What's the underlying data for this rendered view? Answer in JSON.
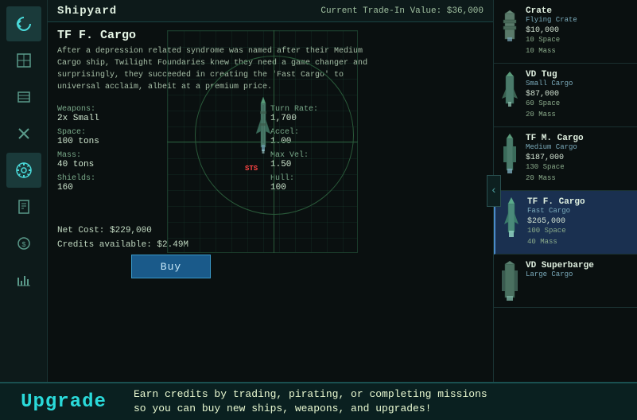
{
  "header": {
    "title": "Shipyard",
    "trade_in": "Current Trade-In Value: $36,000"
  },
  "ship": {
    "name": "TF F. Cargo",
    "description": "After a depression related syndrome was named after their Medium Cargo ship, Twilight Foundaries knew they need a game changer and surprisingly, they succeeded in creating the 'Fast Cargo' to universal acclaim, albeit at a premium price.",
    "weapons_label": "Weapons:",
    "weapons_value": "2x Small",
    "turn_rate_label": "Turn Rate:",
    "turn_rate_value": "1,700",
    "space_label": "Space:",
    "space_value": "100 tons",
    "accel_label": "Accel:",
    "accel_value": "1.00",
    "mass_label": "Mass:",
    "mass_value": "40 tons",
    "max_vel_label": "Max Vel:",
    "max_vel_value": "1.50",
    "shields_label": "Shields:",
    "shields_value": "160",
    "hull_label": "Hull:",
    "hull_value": "100",
    "net_cost": "Net Cost: $229,000",
    "credits": "Credits available: $2.49M",
    "buy_label": "Buy",
    "sts": "STS"
  },
  "ship_list": [
    {
      "name": "Crate",
      "type": "Flying Crate",
      "price": "$10,000",
      "stats": "10 Space\n10 Mass",
      "selected": false
    },
    {
      "name": "VD Tug",
      "type": "Small Cargo",
      "price": "$87,000",
      "stats": "60 Space\n20 Mass",
      "selected": false
    },
    {
      "name": "TF M. Cargo",
      "type": "Medium Cargo",
      "price": "$187,000",
      "stats": "130 Space\n20 Mass",
      "selected": false
    },
    {
      "name": "TF F. Cargo",
      "type": "Fast Cargo",
      "price": "$265,000",
      "stats": "100 Space\n40 Mass",
      "selected": true
    },
    {
      "name": "VD Superbarge",
      "type": "Large Cargo",
      "price": "",
      "stats": "",
      "selected": false
    }
  ],
  "collapse_arrow": "‹",
  "bottom": {
    "upgrade_label": "Upgrade",
    "tip": "Earn credits by trading, pirating, or completing missions\nso you can buy new ships, weapons, and upgrades!"
  },
  "sidebar": {
    "icons": [
      {
        "name": "back-icon",
        "glyph": "↩",
        "active": true
      },
      {
        "name": "map-icon",
        "glyph": "◈",
        "active": false
      },
      {
        "name": "cargo-icon",
        "glyph": "☰",
        "active": false
      },
      {
        "name": "tools-icon",
        "glyph": "✦",
        "active": false
      },
      {
        "name": "helm-icon",
        "glyph": "✿",
        "active": true
      },
      {
        "name": "missions-icon",
        "glyph": "✎",
        "active": false
      },
      {
        "name": "trade-icon",
        "glyph": "◈",
        "active": false
      },
      {
        "name": "finance-icon",
        "glyph": "◐",
        "active": false
      },
      {
        "name": "stats-icon",
        "glyph": "↑",
        "active": false
      }
    ]
  }
}
